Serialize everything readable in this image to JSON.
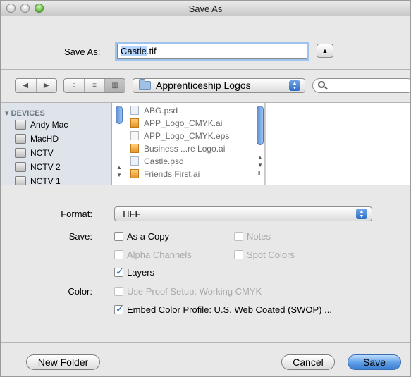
{
  "window": {
    "title": "Save As"
  },
  "save_as": {
    "label": "Save As:",
    "filename_selected": "Castle",
    "filename_rest": ".tif"
  },
  "toolbar": {
    "location": "Apprenticeship Logos",
    "search_placeholder": ""
  },
  "sidebar": {
    "heading": "DEVICES",
    "items": [
      {
        "label": "Andy Mac"
      },
      {
        "label": "MacHD"
      },
      {
        "label": "NCTV"
      },
      {
        "label": "NCTV 2"
      },
      {
        "label": "NCTV 1"
      }
    ]
  },
  "files": [
    {
      "name": "ABG.psd",
      "kind": "psd"
    },
    {
      "name": "APP_Logo_CMYK.ai",
      "kind": "ai"
    },
    {
      "name": "APP_Logo_CMYK.eps",
      "kind": "doc"
    },
    {
      "name": "Business ...re Logo.ai",
      "kind": "ai"
    },
    {
      "name": "Castle.psd",
      "kind": "psd"
    },
    {
      "name": "Friends First.ai",
      "kind": "ai"
    }
  ],
  "options": {
    "format_label": "Format:",
    "format_value": "TIFF",
    "save_label": "Save:",
    "color_label": "Color:",
    "as_copy": {
      "label": "As a Copy",
      "checked": false,
      "enabled": true
    },
    "notes": {
      "label": "Notes",
      "checked": false,
      "enabled": false
    },
    "alpha_channels": {
      "label": "Alpha Channels",
      "checked": false,
      "enabled": false
    },
    "spot_colors": {
      "label": "Spot Colors",
      "checked": false,
      "enabled": false
    },
    "layers": {
      "label": "Layers",
      "checked": true,
      "enabled": true
    },
    "proof_setup": {
      "label": "Use Proof Setup:  Working CMYK",
      "checked": false,
      "enabled": false
    },
    "embed_profile": {
      "label": "Embed Color Profile:  U.S. Web Coated (SWOP) ...",
      "checked": true,
      "enabled": true
    }
  },
  "buttons": {
    "new_folder": "New Folder",
    "cancel": "Cancel",
    "save": "Save"
  },
  "colors": {
    "accent": "#3d7fd1",
    "sidebar_bg": "#dee4ea",
    "window_bg": "#e8e8e8"
  }
}
